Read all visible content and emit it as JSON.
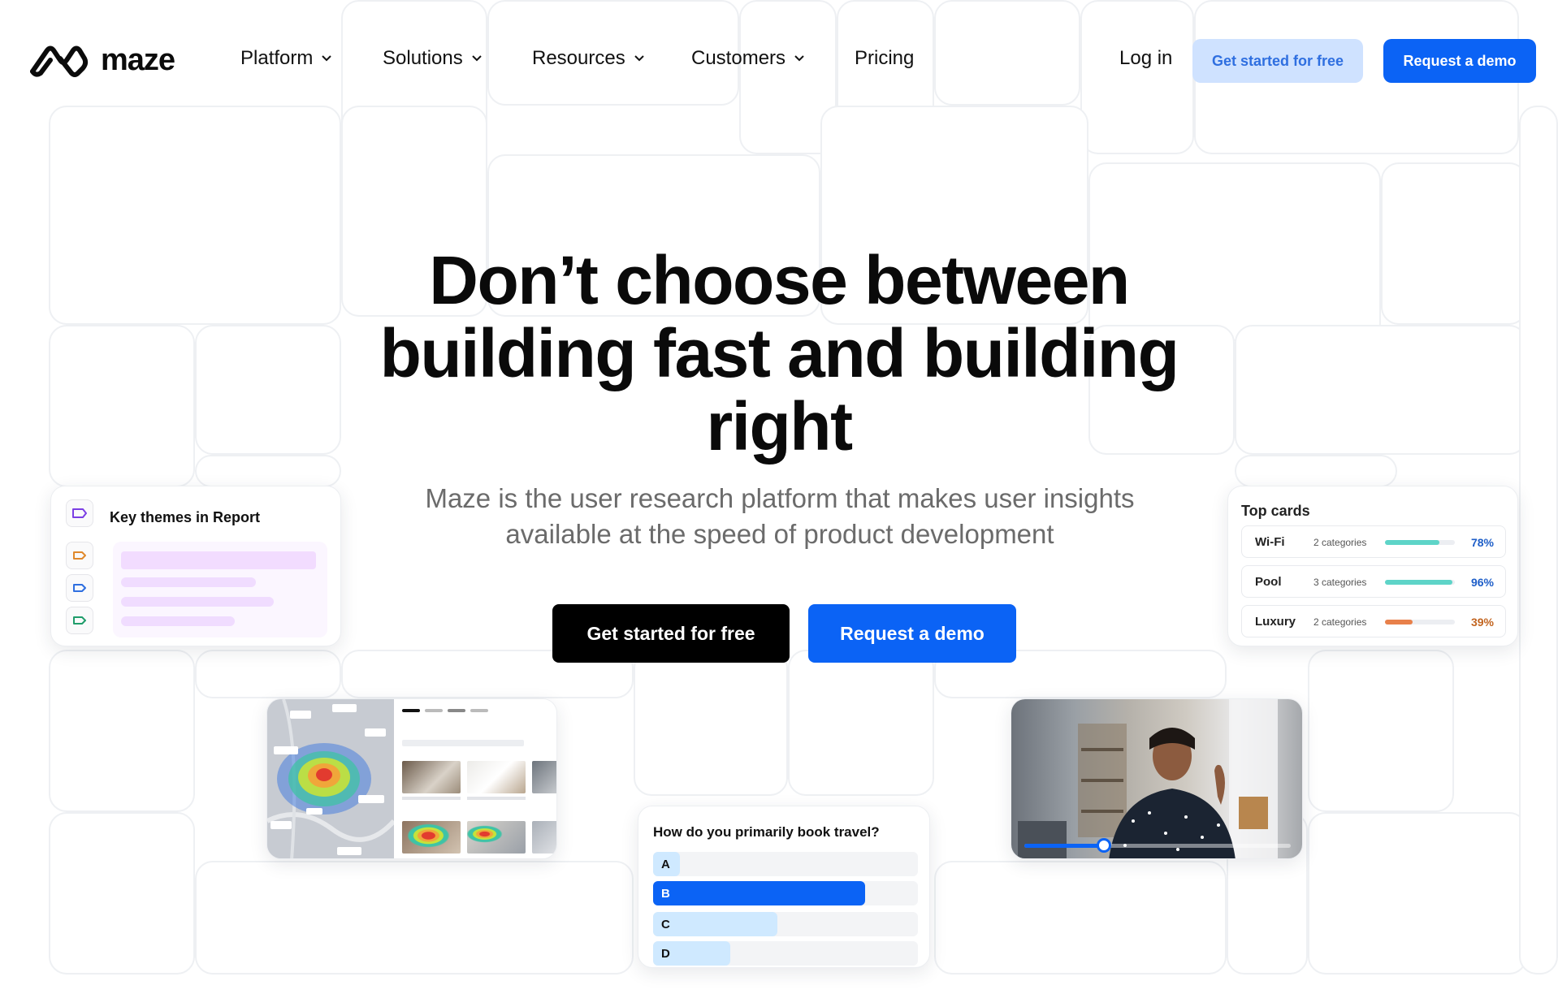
{
  "brand": {
    "name": "maze"
  },
  "nav": {
    "items": [
      {
        "label": "Platform",
        "dropdown": true
      },
      {
        "label": "Solutions",
        "dropdown": true
      },
      {
        "label": "Resources",
        "dropdown": true
      },
      {
        "label": "Customers",
        "dropdown": true
      },
      {
        "label": "Pricing",
        "dropdown": false
      }
    ],
    "login": "Log in",
    "get_started": "Get started for free",
    "request_demo": "Request a demo"
  },
  "hero": {
    "title": "Don’t choose between building fast and building right",
    "subtitle": "Maze is the user research platform that makes user insights available at the speed of product development",
    "cta_primary": "Get started for free",
    "cta_secondary": "Request a demo"
  },
  "key_themes": {
    "title": "Key themes in Report",
    "tag_colors": [
      "#7b3fe4",
      "#e0892b",
      "#2f6fe0",
      "#1f9d6b"
    ]
  },
  "top_cards": {
    "title": "Top cards",
    "rows": [
      {
        "name": "Wi-Fi",
        "categories": "2 categories",
        "percent": "78%",
        "value": 0.78,
        "color": "#5ed4c8"
      },
      {
        "name": "Pool",
        "categories": "3 categories",
        "percent": "96%",
        "value": 0.96,
        "color": "#5ed4c8"
      },
      {
        "name": "Luxury",
        "categories": "2 categories",
        "percent": "39%",
        "value": 0.39,
        "color": "#e8804a"
      }
    ],
    "pct_colors": [
      "#1e5ec8",
      "#1e5ec8",
      "#c2641f"
    ]
  },
  "survey": {
    "question": "How do you primarily book travel?",
    "options": [
      {
        "label": "A",
        "value": 0.1,
        "color": "#cfe9ff",
        "text_color": "#111"
      },
      {
        "label": "B",
        "value": 0.8,
        "color": "#0b63f5",
        "text_color": "#ffffff"
      },
      {
        "label": "C",
        "value": 0.47,
        "color": "#cfe9ff",
        "text_color": "#111"
      },
      {
        "label": "D",
        "value": 0.29,
        "color": "#cfe9ff",
        "text_color": "#111"
      }
    ]
  },
  "video": {
    "progress": 0.3
  },
  "colors": {
    "accent": "#0b63f5",
    "accent_light": "#cfe2ff",
    "text": "#0b0b0b",
    "subtle_text": "#6b6b6b"
  }
}
